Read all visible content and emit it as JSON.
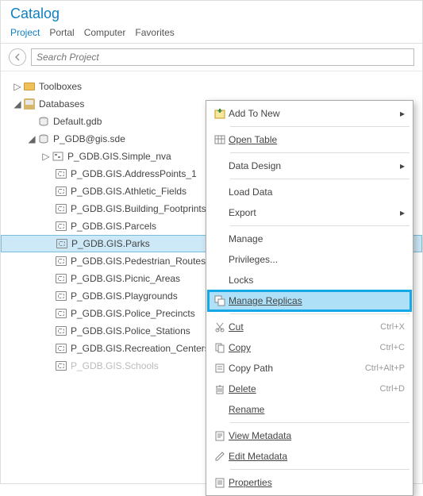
{
  "title": "Catalog",
  "tabs": [
    "Project",
    "Portal",
    "Computer",
    "Favorites"
  ],
  "active_tab": 0,
  "search": {
    "placeholder": "Search Project"
  },
  "tree": {
    "toolboxes": "Toolboxes",
    "databases": "Databases",
    "default_gdb": "Default.gdb",
    "sde": "P_GDB@gis.sde",
    "sde_children": [
      "P_GDB.GIS.Simple_nva",
      "P_GDB.GIS.AddressPoints_1",
      "P_GDB.GIS.Athletic_Fields",
      "P_GDB.GIS.Building_Footprints",
      "P_GDB.GIS.Parcels",
      "P_GDB.GIS.Parks",
      "P_GDB.GIS.Pedestrian_Routes",
      "P_GDB.GIS.Picnic_Areas",
      "P_GDB.GIS.Playgrounds",
      "P_GDB.GIS.Police_Precincts",
      "P_GDB.GIS.Police_Stations",
      "P_GDB.GIS.Recreation_Centers",
      "P_GDB.GIS.Schools"
    ]
  },
  "menu": {
    "add_to_new": "Add To New",
    "open_table": "Open Table",
    "data_design": "Data Design",
    "load_data": "Load Data",
    "export": "Export",
    "manage": "Manage",
    "privileges": "Privileges...",
    "locks": "Locks",
    "manage_replicas": "Manage Replicas",
    "cut": "Cut",
    "copy": "Copy",
    "copy_path": "Copy Path",
    "delete": "Delete",
    "rename": "Rename",
    "view_metadata": "View Metadata",
    "edit_metadata": "Edit Metadata",
    "properties": "Properties",
    "sc_cut": "Ctrl+X",
    "sc_copy": "Ctrl+C",
    "sc_copy_path": "Ctrl+Alt+P",
    "sc_delete": "Ctrl+D"
  }
}
